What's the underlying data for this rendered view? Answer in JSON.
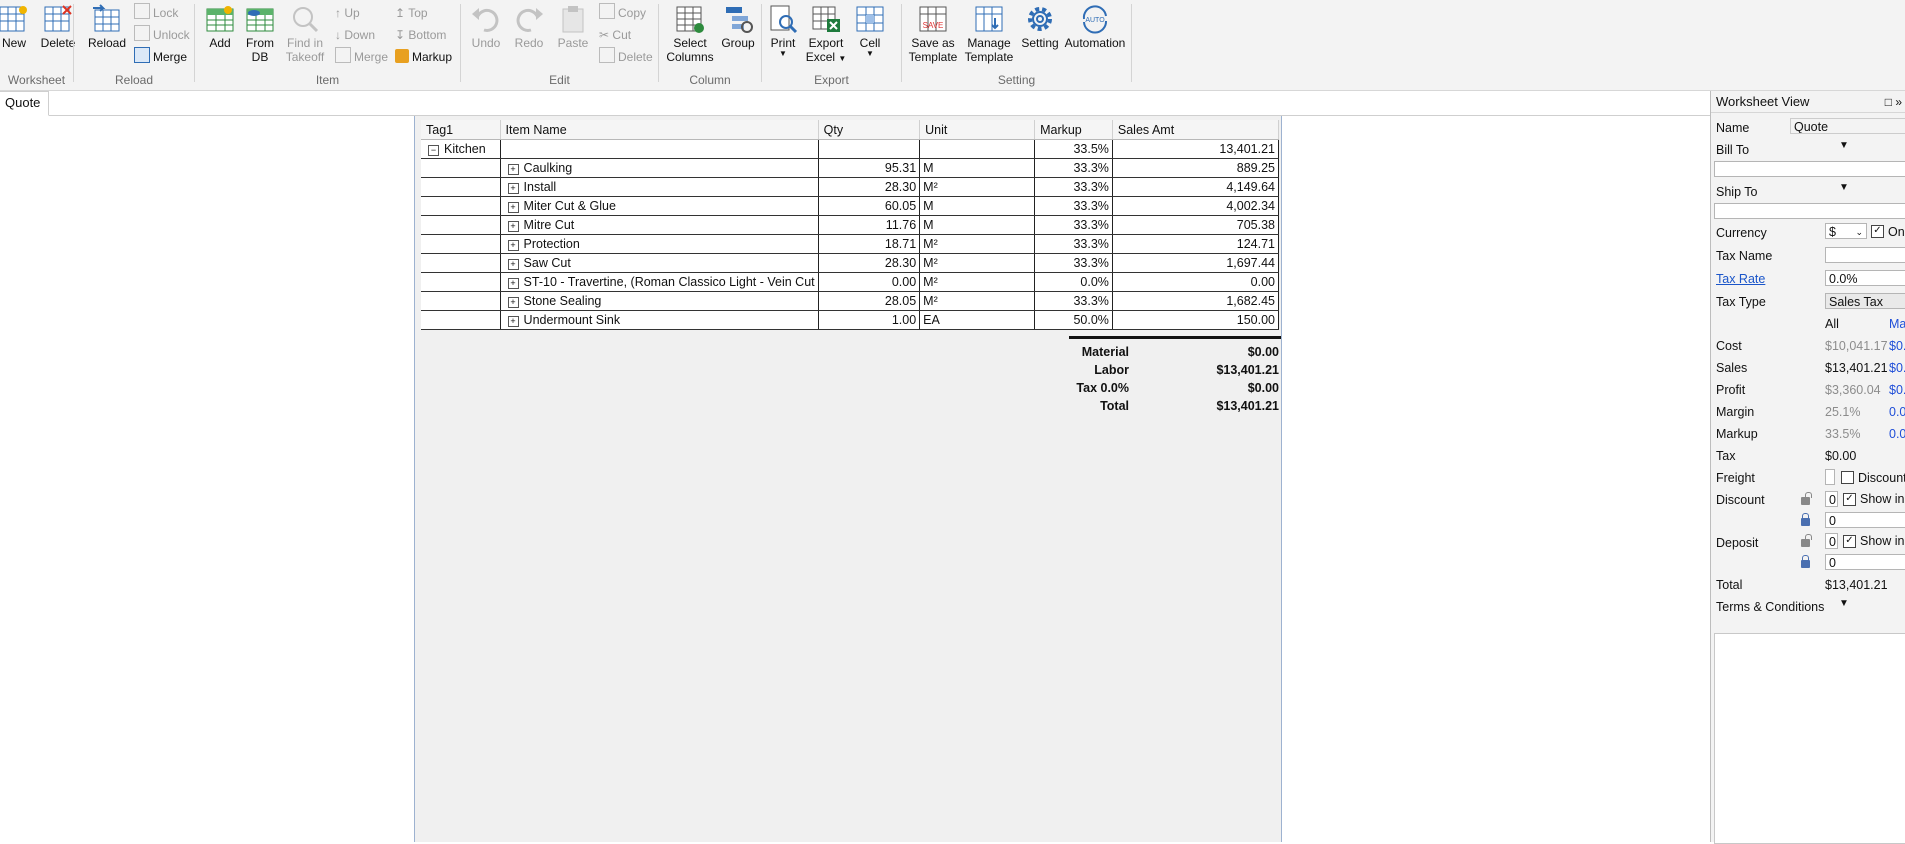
{
  "ribbon": {
    "worksheet": {
      "label": "Worksheet",
      "new": "New",
      "delete": "Delete"
    },
    "reload": {
      "label": "Reload",
      "reload": "Reload",
      "lock": "Lock",
      "unlock": "Unlock",
      "merge": "Merge"
    },
    "item": {
      "label": "Item",
      "add": "Add",
      "from_db_1": "From",
      "from_db_2": "DB",
      "find_1": "Find in",
      "find_2": "Takeoff",
      "up": "Up",
      "down": "Down",
      "merge": "Merge",
      "top": "Top",
      "bottom": "Bottom",
      "markup": "Markup"
    },
    "edit": {
      "label": "Edit",
      "undo": "Undo",
      "redo": "Redo",
      "paste": "Paste",
      "copy": "Copy",
      "cut": "Cut",
      "delete": "Delete"
    },
    "column": {
      "label": "Column",
      "select_1": "Select",
      "select_2": "Columns",
      "group": "Group"
    },
    "export": {
      "label": "Export",
      "print": "Print",
      "excel_1": "Export",
      "excel_2": "Excel",
      "cell": "Cell"
    },
    "setting": {
      "label": "Setting",
      "save_1": "Save as",
      "save_2": "Template",
      "manage_1": "Manage",
      "manage_2": "Template",
      "setting": "Setting",
      "automation": "Automation"
    }
  },
  "tabs": [
    "Quote"
  ],
  "grid": {
    "headers": [
      "Tag1",
      "Item Name",
      "Qty",
      "Unit",
      "Markup",
      "Sales Amt"
    ],
    "group_row": {
      "tag": "Kitchen",
      "markup": "33.5%",
      "sales": "13,401.21"
    },
    "rows": [
      {
        "name": "Caulking",
        "qty": "95.31",
        "unit": "M",
        "markup": "33.3%",
        "sales": "889.25"
      },
      {
        "name": "Install",
        "qty": "28.30",
        "unit": "M²",
        "markup": "33.3%",
        "sales": "4,149.64"
      },
      {
        "name": "Miter Cut & Glue",
        "qty": "60.05",
        "unit": "M",
        "markup": "33.3%",
        "sales": "4,002.34"
      },
      {
        "name": "Mitre Cut",
        "qty": "11.76",
        "unit": "M",
        "markup": "33.3%",
        "sales": "705.38"
      },
      {
        "name": "Protection",
        "qty": "18.71",
        "unit": "M²",
        "markup": "33.3%",
        "sales": "124.71"
      },
      {
        "name": "Saw Cut",
        "qty": "28.30",
        "unit": "M²",
        "markup": "33.3%",
        "sales": "1,697.44"
      },
      {
        "name": "ST-10 - Travertine, (Roman Classico Light - Vein Cut",
        "qty": "0.00",
        "unit": "M²",
        "markup": "0.0%",
        "sales": "0.00"
      },
      {
        "name": "Stone Sealing",
        "qty": "28.05",
        "unit": "M²",
        "markup": "33.3%",
        "sales": "1,682.45"
      },
      {
        "name": "Undermount Sink",
        "qty": "1.00",
        "unit": "EA",
        "markup": "50.0%",
        "sales": "150.00"
      }
    ],
    "totals": [
      {
        "label": "Material",
        "value": "$0.00"
      },
      {
        "label": "Labor",
        "value": "$13,401.21"
      },
      {
        "label": "Tax 0.0%",
        "value": "$0.00"
      },
      {
        "label": "Total",
        "value": "$13,401.21"
      }
    ]
  },
  "panel": {
    "title": "Worksheet View",
    "name_label": "Name",
    "name_value": "Quote",
    "bill_to": "Bill To",
    "ship_to": "Ship To",
    "currency_label": "Currency",
    "currency_value": "$",
    "currency_check": "On",
    "tax_name": "Tax Name",
    "tax_rate": "Tax Rate",
    "tax_rate_value": "0.0%",
    "tax_type": "Tax Type",
    "tax_type_value": "Sales Tax",
    "col_all": "All",
    "col_ma": "Ma",
    "cost": "Cost",
    "cost_all": "$10,041.17",
    "cost_ma": "$0.",
    "sales": "Sales",
    "sales_all": "$13,401.21",
    "sales_ma": "$0.",
    "profit": "Profit",
    "profit_all": "$3,360.04",
    "profit_ma": "$0.",
    "margin": "Margin",
    "margin_all": "25.1%",
    "margin_ma": "0.0",
    "markup": "Markup",
    "markup_all": "33.5%",
    "markup_ma": "0.0",
    "tax": "Tax",
    "tax_value": "$0.00",
    "freight": "Freight",
    "freight_discount": "Discount",
    "discount": "Discount",
    "discount_1": "0",
    "discount_show": "Show in",
    "discount_2": "0",
    "deposit": "Deposit",
    "deposit_1": "0",
    "deposit_show": "Show in",
    "deposit_2": "0",
    "total": "Total",
    "total_value": "$13,401.21",
    "terms": "Terms & Conditions"
  }
}
